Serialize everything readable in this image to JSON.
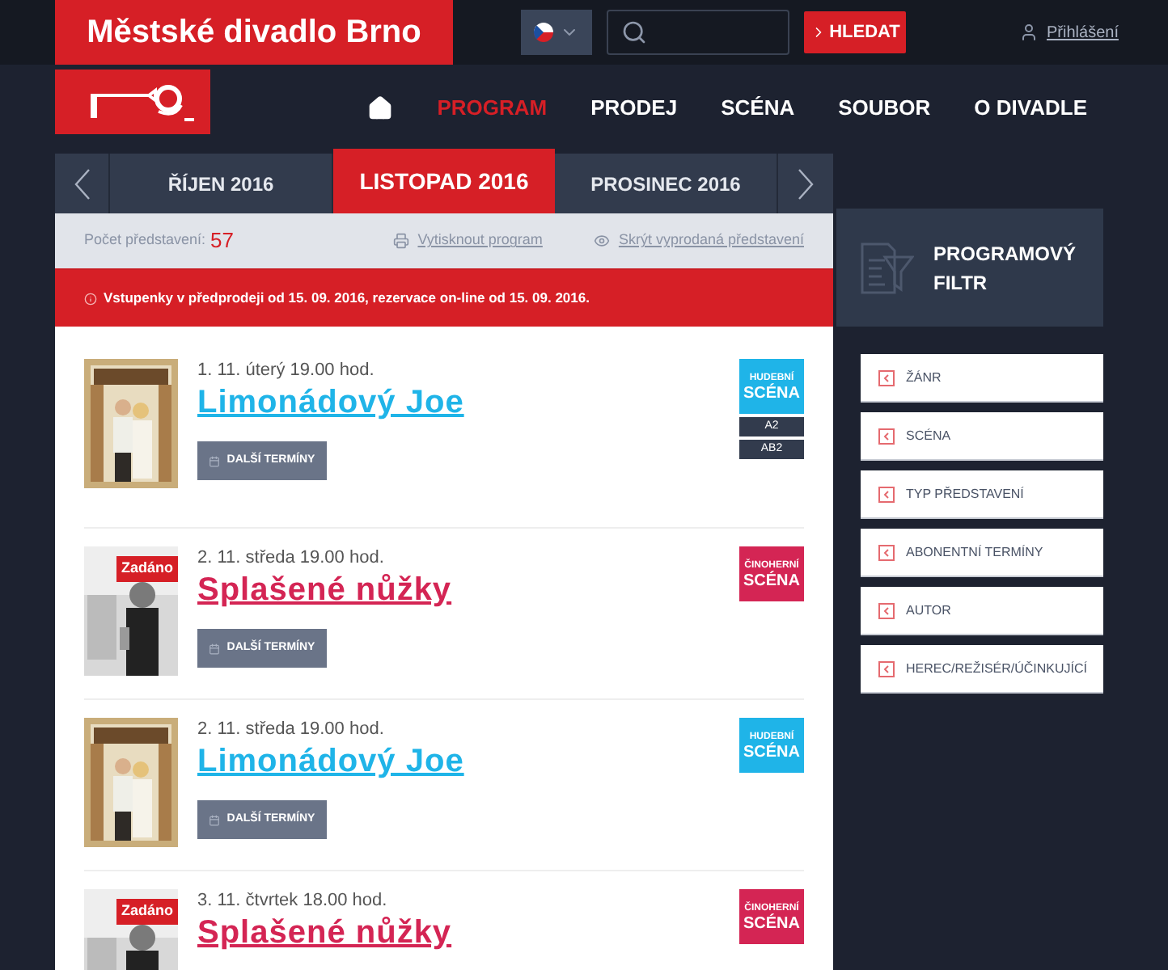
{
  "header": {
    "site_title": "Městské divadlo Brno",
    "search_button": "HLEDAT",
    "login": "Přihlášení"
  },
  "nav": {
    "items": [
      {
        "label": "PROGRAM",
        "selected": true
      },
      {
        "label": "PRODEJ",
        "selected": false
      },
      {
        "label": "SCÉNA",
        "selected": false
      },
      {
        "label": "SOUBOR",
        "selected": false
      },
      {
        "label": "O DIVADLE",
        "selected": false
      }
    ]
  },
  "months": [
    {
      "label": "ŘÍJEN 2016",
      "selected": false
    },
    {
      "label": "LISTOPAD 2016",
      "selected": true
    },
    {
      "label": "PROSINEC 2016",
      "selected": false
    }
  ],
  "info": {
    "count_label": "Počet představení:",
    "count": "57",
    "print_link": "Vytisknout program",
    "hide_link": "Skrýt vyprodaná představení"
  },
  "notice": "Vstupenky v předprodeji od 15. 09. 2016, rezervace on-line od 15. 09. 2016.",
  "events": [
    {
      "date": "1. 11. úterý 19.00 hod.",
      "title": "Limonádový Joe",
      "color": "#1fb4e8",
      "button": "DALŠÍ TERMÍNY",
      "scene": [
        "HUDEBNÍ",
        "SCÉNA"
      ],
      "tags": [
        "A2",
        "AB2"
      ]
    },
    {
      "date": "2. 11. středa 19.00 hod.",
      "title": "Splašené nůžky",
      "color": "#d42554",
      "button": "DALŠÍ TERMÍNY",
      "scene": [
        "ČINOHERNÍ",
        "SCÉNA"
      ],
      "overlay": "Zadáno"
    },
    {
      "date": "2. 11. středa 19.00 hod.",
      "title": "Limonádový Joe",
      "color": "#1fb4e8",
      "button": "DALŠÍ TERMÍNY",
      "scene": [
        "HUDEBNÍ",
        "SCÉNA"
      ]
    },
    {
      "date": "3. 11. čtvrtek 18.00 hod.",
      "title": "Splašené nůžky",
      "color": "#d42554",
      "scene": [
        "ČINOHERNÍ",
        "SCÉNA"
      ],
      "overlay": "Zadáno"
    }
  ],
  "filter": {
    "title": [
      "PROGRAMOVÝ",
      "FILTR"
    ],
    "items": [
      "ŽÁNR",
      "SCÉNA",
      "TYP PŘEDSTAVENÍ",
      "ABONENTNÍ TERMÍNY",
      "AUTOR",
      "HEREC/REŽISÉR/ÚČINKUJÍCÍ"
    ]
  }
}
